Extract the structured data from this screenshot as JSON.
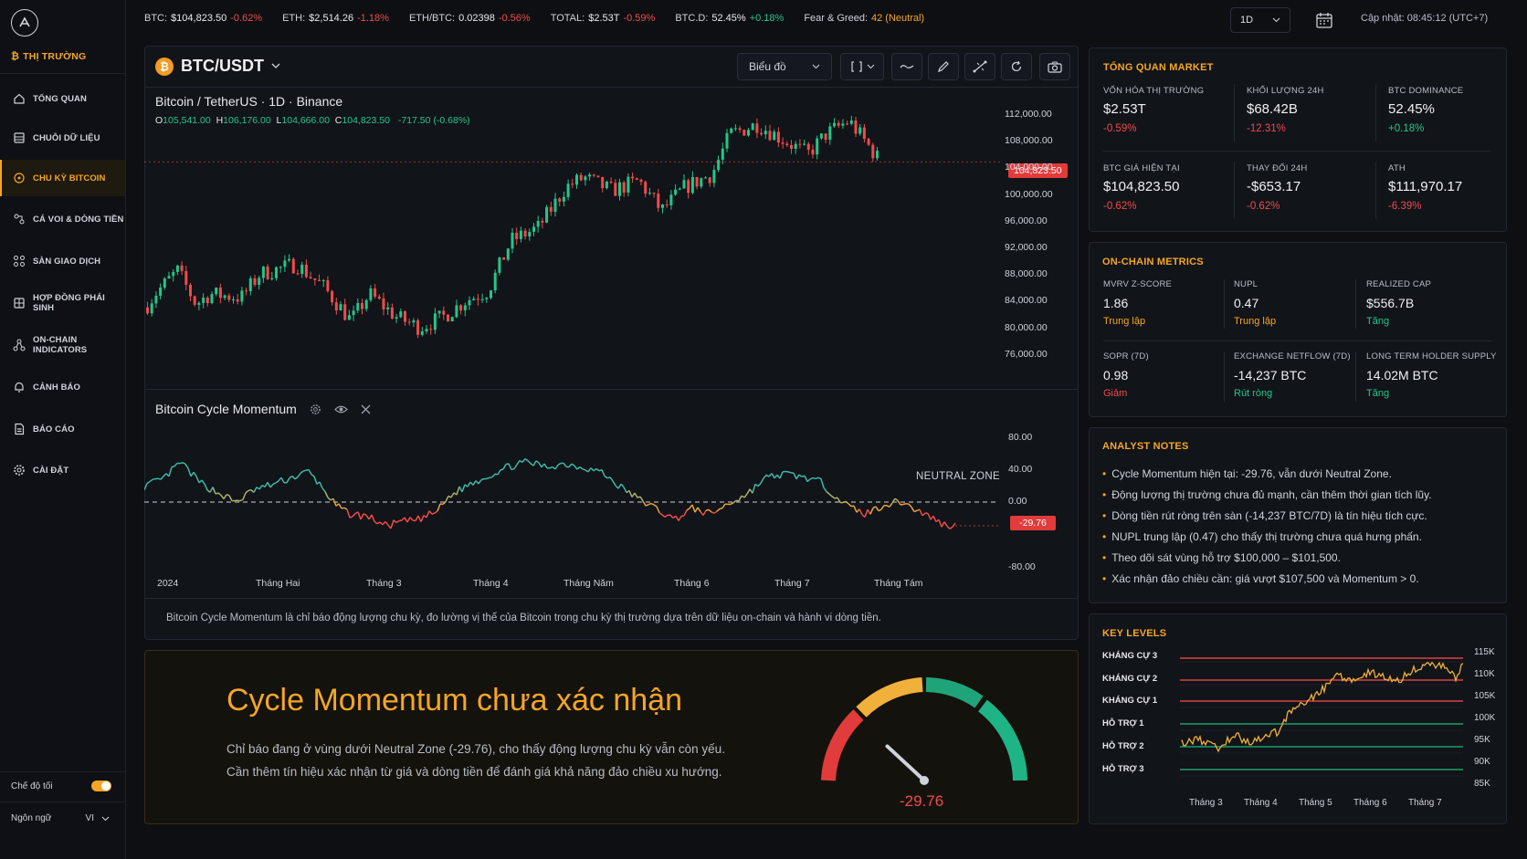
{
  "sidebar": {
    "market_label": "THỊ TRƯỜNG",
    "items": [
      {
        "label": "TỔNG QUAN"
      },
      {
        "label": "CHUỖI DỮ LIỆU"
      },
      {
        "label": "CHU KỲ BITCOIN"
      },
      {
        "label": "CÁ VOI & DÒNG TIỀN"
      },
      {
        "label": "SÀN GIAO DỊCH"
      },
      {
        "label": "HỢP ĐỒNG PHÁI SINH"
      },
      {
        "label": "ON-CHAIN INDICATORS"
      },
      {
        "label": "CẢNH BÁO"
      },
      {
        "label": "BÁO CÁO"
      },
      {
        "label": "CÀI ĐẶT"
      }
    ],
    "dark_mode_label": "Chế độ tối",
    "language_label": "Ngôn ngữ",
    "language_value": "VI"
  },
  "ticker": [
    {
      "key": "BTC:",
      "value": "$104,823.50",
      "change": "-0.62%",
      "dir": "down"
    },
    {
      "key": "ETH:",
      "value": "$2,514.26",
      "change": "-1.18%",
      "dir": "down"
    },
    {
      "key": "ETH/BTC:",
      "value": "0.02398",
      "change": "-0.56%",
      "dir": "down"
    },
    {
      "key": "TOTAL:",
      "value": "$2.53T",
      "change": "-0.59%",
      "dir": "down"
    },
    {
      "key": "BTC.D:",
      "value": "52.45%",
      "change": "+0.18%",
      "dir": "up"
    },
    {
      "key": "Fear & Greed:",
      "value": "",
      "change": "42 (Neutral)",
      "dir": "neutral"
    }
  ],
  "header": {
    "timeframe": "1D",
    "updated": "Cập nhật: 08:45:12 (UTC+7)"
  },
  "chart": {
    "pair": "BTC/USDT",
    "coin_glyph": "₿",
    "chart_type": "Biểu đồ",
    "symbol_line": "Bitcoin / TetherUS · 1D · Binance",
    "ohlc": {
      "o": "105,541.00",
      "h": "106,176.00",
      "l": "104,666.00",
      "c": "104,823.50",
      "chg": "-717.50 (-0.68%)"
    },
    "price_tag": "104,823.50",
    "y_labels": [
      "112,000.00",
      "108,000.00",
      "104,000.00",
      "100,000.00",
      "96,000.00",
      "92,000.00",
      "88,000.00",
      "84,000.00",
      "80,000.00",
      "76,000.00"
    ],
    "momentum_title": "Bitcoin Cycle Momentum",
    "neutral_zone": "NEUTRAL ZONE",
    "momentum_y_labels": [
      "80.00",
      "40.00",
      "0.00",
      "-80.00"
    ],
    "momentum_tag": "-29.76",
    "x_labels": [
      "2024",
      "Tháng Hai",
      "Tháng 3",
      "Tháng 4",
      "Tháng Năm",
      "Tháng 6",
      "Tháng 7",
      "Tháng Tám"
    ],
    "description": "Bitcoin Cycle Momentum là chỉ báo động lượng chu kỳ, đo lường vị thế của Bitcoin trong chu kỳ thị trường dựa trên dữ liệu on-chain và hành vi dòng tiền."
  },
  "banner": {
    "title": "Cycle Momentum chưa xác nhận",
    "line1": "Chỉ báo đang ở vùng dưới Neutral Zone (-29.76), cho thấy động lượng chu kỳ vẫn còn yếu.",
    "line2": "Cần thêm tín hiệu xác nhận từ giá và dòng tiền để đánh giá khả năng đảo chiều xu hướng.",
    "gauge_value": "-29.76",
    "gauge_level": -29.76
  },
  "overview": {
    "title": "TỔNG QUAN MARKET",
    "metrics": [
      {
        "label": "VỐN HÓA THỊ TRƯỜNG",
        "value": "$2.53T",
        "sub": "-0.59%",
        "dir": "down"
      },
      {
        "label": "KHỐI LƯỢNG 24H",
        "value": "$68.42B",
        "sub": "-12.31%",
        "dir": "down"
      },
      {
        "label": "BTC DOMINANCE",
        "value": "52.45%",
        "sub": "+0.18%",
        "dir": "up"
      },
      {
        "label": "BTC GIÁ HIỆN TẠI",
        "value": "$104,823.50",
        "sub": "-0.62%",
        "dir": "down"
      },
      {
        "label": "THAY ĐỔI 24H",
        "value": "-$653.17",
        "sub": "-0.62%",
        "dir": "down"
      },
      {
        "label": "ATH",
        "value": "$111,970.17",
        "sub": "-6.39%",
        "dir": "down"
      }
    ]
  },
  "onchain": {
    "title": "ON-CHAIN METRICS",
    "metrics": [
      {
        "label": "MVRV Z-SCORE",
        "value": "1.86",
        "sub": "Trung lập",
        "dir": "neutral"
      },
      {
        "label": "NUPL",
        "value": "0.47",
        "sub": "Trung lập",
        "dir": "neutral"
      },
      {
        "label": "REALIZED CAP",
        "value": "$556.7B",
        "sub": "Tăng",
        "dir": "up"
      },
      {
        "label": "SOPR (7D)",
        "value": "0.98",
        "sub": "Giảm",
        "dir": "down"
      },
      {
        "label": "EXCHANGE NETFLOW (7D)",
        "value": "-14,237 BTC",
        "sub": "Rút ròng",
        "dir": "up"
      },
      {
        "label": "LONG TERM HOLDER SUPPLY",
        "value": "14.02M BTC",
        "sub": "Tăng",
        "dir": "up"
      }
    ]
  },
  "notes": {
    "title": "ANALYST NOTES",
    "bullet": "•",
    "items": [
      "Cycle Momentum hiện tại: -29.76, vẫn dưới Neutral Zone.",
      "Động lượng thị trường chưa đủ mạnh, cần thêm thời gian tích lũy.",
      "Dòng tiền rút ròng trên sàn (-14,237 BTC/7D) là tín hiệu tích cực.",
      "NUPL trung lập (0.47) cho thấy thị trường chưa quá hưng phấn.",
      "Theo dõi sát vùng hỗ trợ $100,000 – $101,500.",
      "Xác nhận đảo chiều cần: giá vượt $107,500 và Momentum > 0."
    ]
  },
  "key_levels": {
    "title": "KEY LEVELS",
    "levels": [
      {
        "label": "KHÁNG CỰ 3",
        "type": "resistance"
      },
      {
        "label": "KHÁNG CỰ 2",
        "type": "resistance"
      },
      {
        "label": "KHÁNG CỰ 1",
        "type": "resistance"
      },
      {
        "label": "HỖ TRỢ 1",
        "type": "support"
      },
      {
        "label": "HỖ TRỢ 2",
        "type": "support"
      },
      {
        "label": "HỖ TRỢ 3",
        "type": "support"
      }
    ],
    "y_labels": [
      "115K",
      "110K",
      "105K",
      "100K",
      "95K",
      "90K",
      "85K"
    ],
    "x_labels": [
      "Tháng 3",
      "Tháng 4",
      "Tháng 5",
      "Tháng 6",
      "Tháng 7"
    ]
  },
  "colors": {
    "accent": "#f5a623",
    "up": "#23c68a",
    "down": "#ef4b4b",
    "bg": "#0d0f13",
    "panel": "#111419"
  }
}
